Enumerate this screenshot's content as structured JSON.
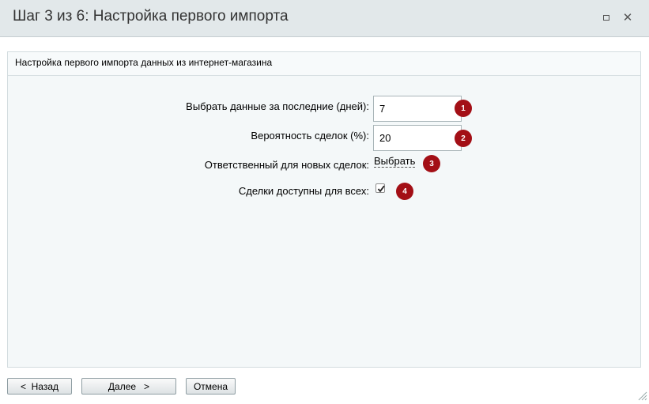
{
  "dialog": {
    "title": "Шаг 3 из 6: Настройка первого импорта"
  },
  "panel": {
    "header": "Настройка первого импорта данных из интернет-магазина"
  },
  "form": {
    "days_label": "Выбрать данные за последние (дней):",
    "days_value": "7",
    "probability_label": "Вероятность сделок (%):",
    "probability_value": "20",
    "responsible_label": "Ответственный для новых сделок:",
    "responsible_link": "Выбрать",
    "public_label": "Сделки доступны для всех:",
    "public_checked": true
  },
  "badges": [
    "1",
    "2",
    "3",
    "4"
  ],
  "buttons": {
    "back": "<  Назад",
    "next": "Далее   >",
    "cancel": "Отмена"
  },
  "icons": {
    "maximize": "maximize-icon",
    "close": "close-icon",
    "checkmark": "checkmark-icon",
    "resize": "resize-grip-icon"
  },
  "colors": {
    "titlebar": "#e2e8ea",
    "panel": "#f4f8f9",
    "badge": "#a30f16"
  }
}
